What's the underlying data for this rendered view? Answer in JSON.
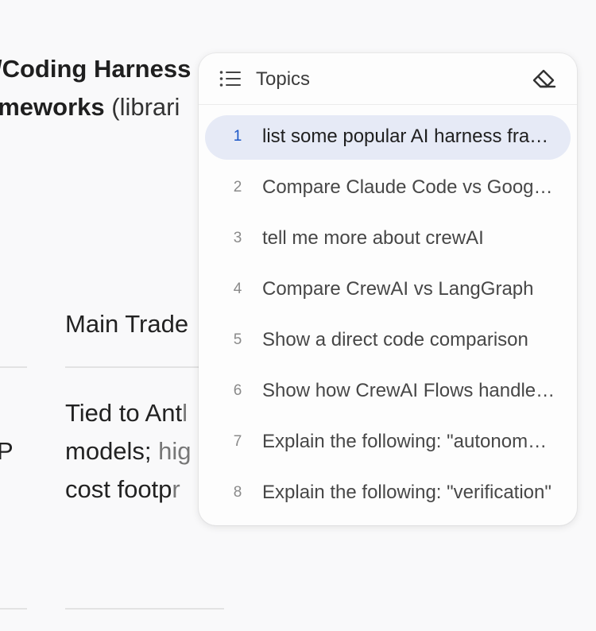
{
  "background": {
    "heading_line_1": "/Coding Harness",
    "heading_line_2_strong": "ameworks",
    "heading_line_2_normal": " (librari",
    "table_header": "Main Trade",
    "cell_line_1_a": "Tied to Ant",
    "cell_line_1_b": "l",
    "cell_line_2_a": "models; ",
    "cell_line_2_b": "hig",
    "cell_line_3_a": "cost footp",
    "cell_line_3_b": "r",
    "left_fragment": "P"
  },
  "panel": {
    "title": "Topics",
    "list_icon": "list-icon",
    "clear_icon": "eraser-icon",
    "active_index": 0,
    "accent_color": "#1a56c7",
    "active_bg": "#e6eaf6",
    "topics": [
      {
        "num": "1",
        "label": "list some popular AI harness frameworks"
      },
      {
        "num": "2",
        "label": "Compare Claude Code vs Google Antigravity"
      },
      {
        "num": "3",
        "label": "tell me more about crewAI"
      },
      {
        "num": "4",
        "label": "Compare CrewAI vs LangGraph"
      },
      {
        "num": "5",
        "label": "Show a direct code comparison"
      },
      {
        "num": "6",
        "label": "Show how CrewAI Flows handle state"
      },
      {
        "num": "7",
        "label": "Explain the following:  \"autonomous agents\""
      },
      {
        "num": "8",
        "label": "Explain the following:  \"verification\""
      }
    ]
  }
}
